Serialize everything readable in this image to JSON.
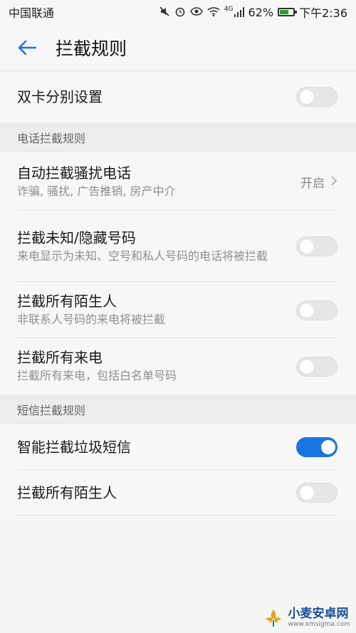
{
  "status": {
    "carrier": "中国联通",
    "battery_percent": "62%",
    "time": "下午2:36",
    "network": "4G",
    "icons": [
      "mute-icon",
      "alarm-icon",
      "eye-icon",
      "wifi-icon",
      "signal-icon",
      "battery-icon"
    ]
  },
  "appbar": {
    "title": "拦截规则"
  },
  "dual_sim": {
    "label": "双卡分别设置",
    "enabled": false
  },
  "phone_rules": {
    "header": "电话拦截规则",
    "items": [
      {
        "title": "自动拦截骚扰电话",
        "subtitle": "诈骗, 骚扰, 广告推销, 房产中介",
        "value": "开启",
        "type": "link"
      },
      {
        "title": "拦截未知/隐藏号码",
        "subtitle": "来电显示为未知、空号和私人号码的电话将被拦截",
        "enabled": false,
        "type": "switch"
      },
      {
        "title": "拦截所有陌生人",
        "subtitle": "非联系人号码的来电将被拦截",
        "enabled": false,
        "type": "switch"
      },
      {
        "title": "拦截所有来电",
        "subtitle": "拦截所有来电，包括白名单号码",
        "enabled": false,
        "type": "switch"
      }
    ]
  },
  "sms_rules": {
    "header": "短信拦截规则",
    "items": [
      {
        "title": "智能拦截垃圾短信",
        "enabled": true
      },
      {
        "title": "拦截所有陌生人",
        "enabled": false
      }
    ]
  },
  "watermark": {
    "title": "小麦安卓网",
    "url": "www.xmsigma.com"
  },
  "colors": {
    "accent": "#1b74e4",
    "switch_off": "#e6e6e6",
    "battery": "#2aa12a"
  }
}
